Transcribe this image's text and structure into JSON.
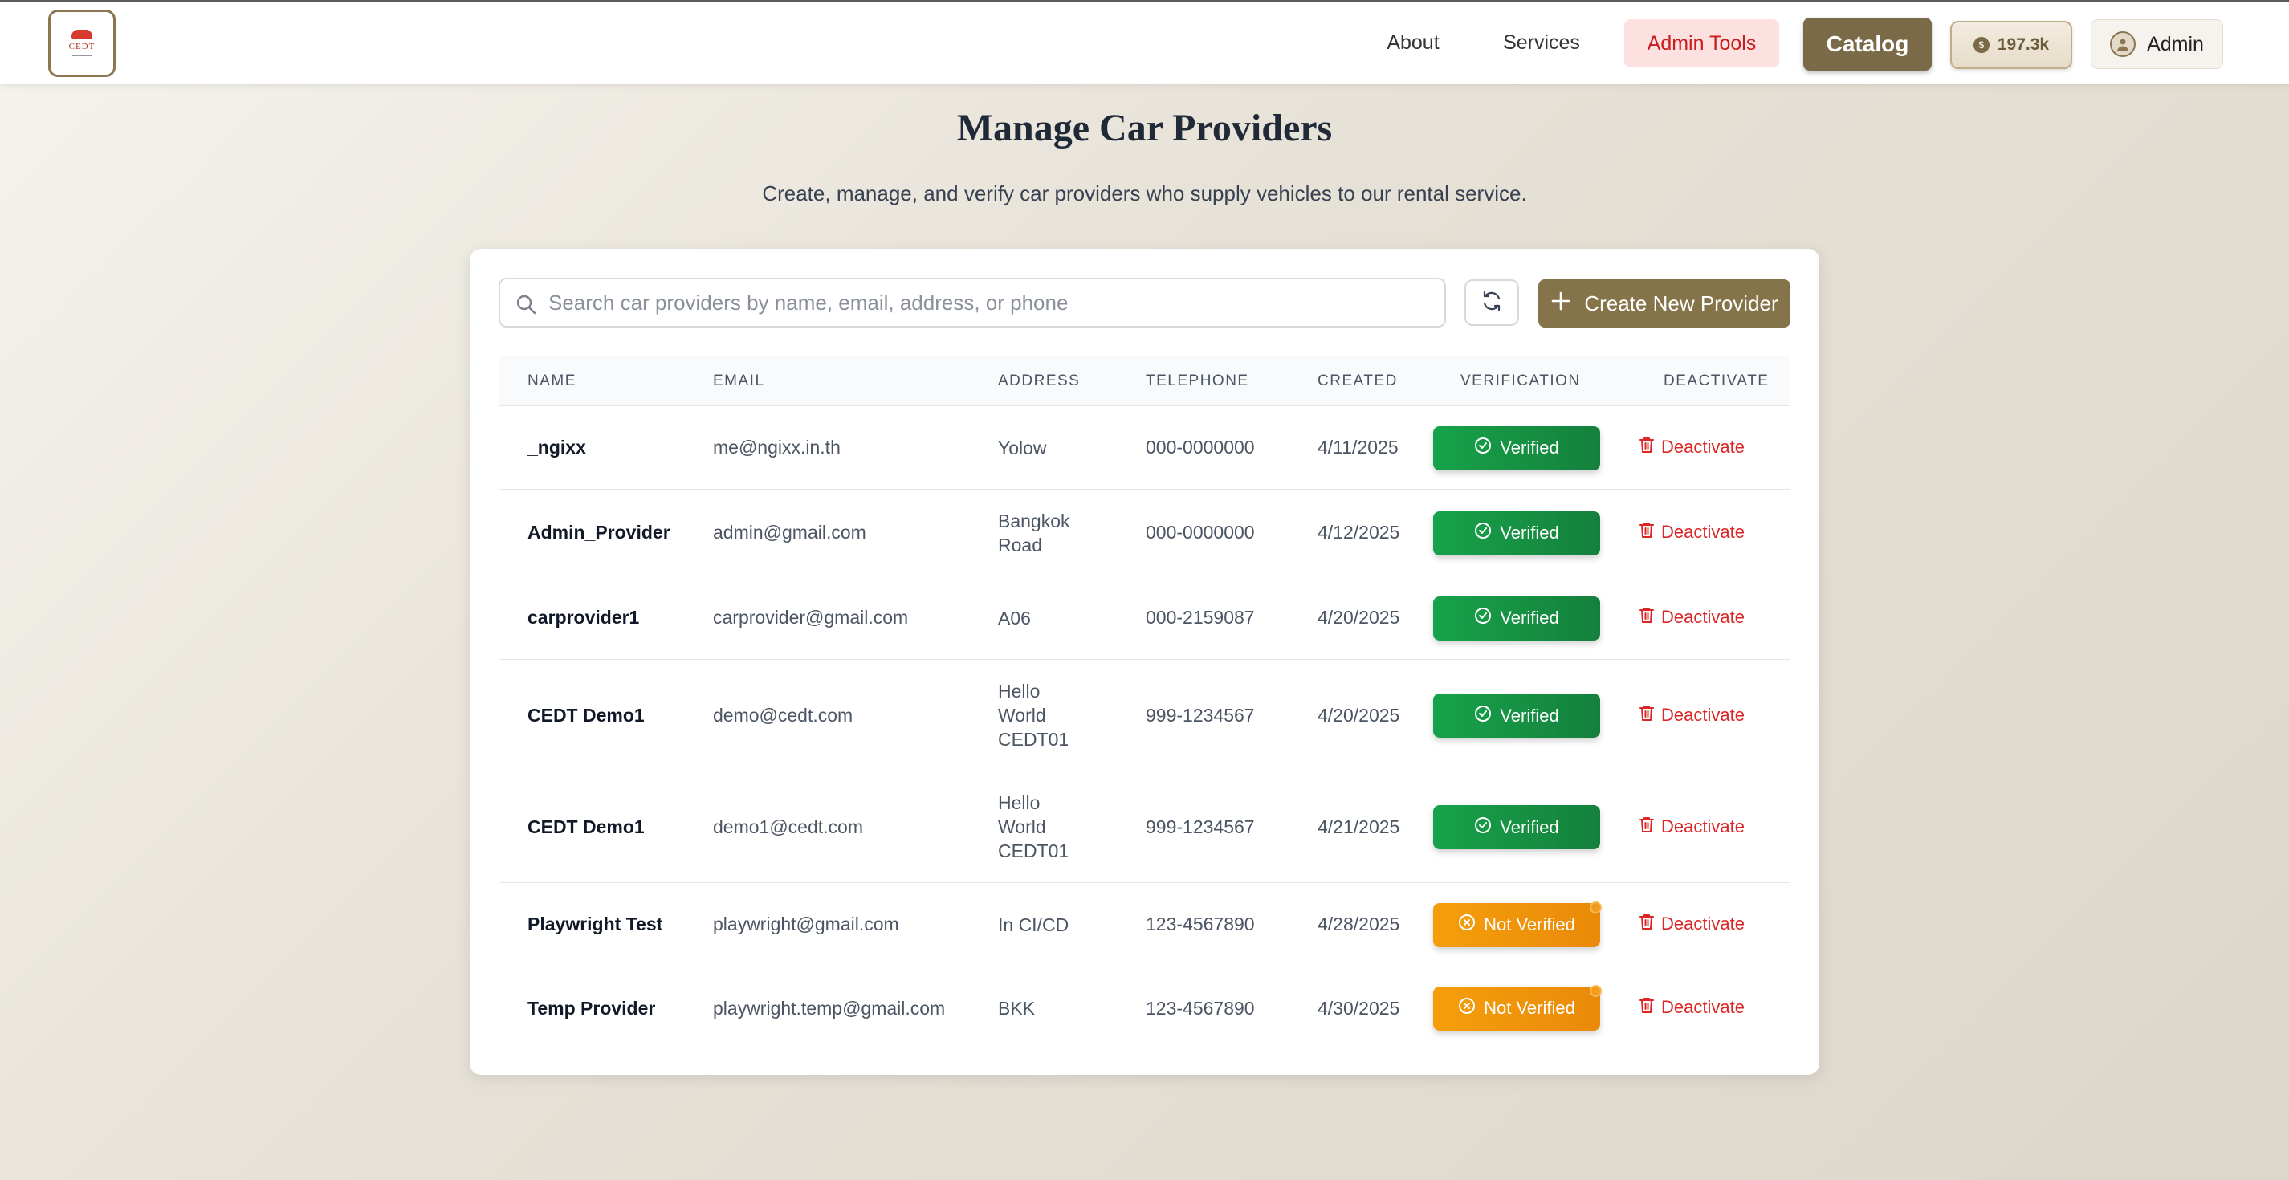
{
  "header": {
    "logo_text": "CEDT",
    "nav": {
      "about": "About",
      "services": "Services"
    },
    "admin_tools": "Admin Tools",
    "catalog": "Catalog",
    "credits": "197.3k",
    "user": "Admin"
  },
  "page": {
    "title": "Manage Car Providers",
    "subtitle": "Create, manage, and verify car providers who supply vehicles to our rental service."
  },
  "toolbar": {
    "search_placeholder": "Search car providers by name, email, address, or phone",
    "create_label": "Create New Provider"
  },
  "table": {
    "headers": [
      "NAME",
      "EMAIL",
      "ADDRESS",
      "TELEPHONE",
      "CREATED",
      "VERIFICATION",
      "DEACTIVATE"
    ],
    "rows": [
      {
        "name": "_ngixx",
        "email": "me@ngixx.in.th",
        "address": [
          "Yolow"
        ],
        "telephone": "000-0000000",
        "created": "4/11/2025",
        "verification": "Verified",
        "verified": true,
        "action": "Deactivate"
      },
      {
        "name": "Admin_Provider",
        "email": "admin@gmail.com",
        "address": [
          "Bangkok",
          "Road"
        ],
        "telephone": "000-0000000",
        "created": "4/12/2025",
        "verification": "Verified",
        "verified": true,
        "action": "Deactivate"
      },
      {
        "name": "carprovider1",
        "email": "carprovider@gmail.com",
        "address": [
          "A06"
        ],
        "telephone": "000-2159087",
        "created": "4/20/2025",
        "verification": "Verified",
        "verified": true,
        "action": "Deactivate"
      },
      {
        "name": "CEDT Demo1",
        "email": "demo@cedt.com",
        "address": [
          "Hello",
          "World",
          "CEDT01"
        ],
        "telephone": "999-1234567",
        "created": "4/20/2025",
        "verification": "Verified",
        "verified": true,
        "action": "Deactivate"
      },
      {
        "name": "CEDT Demo1",
        "email": "demo1@cedt.com",
        "address": [
          "Hello",
          "World",
          "CEDT01"
        ],
        "telephone": "999-1234567",
        "created": "4/21/2025",
        "verification": "Verified",
        "verified": true,
        "action": "Deactivate"
      },
      {
        "name": "Playwright Test",
        "email": "playwright@gmail.com",
        "address": [
          "In CI/CD"
        ],
        "telephone": "123-4567890",
        "created": "4/28/2025",
        "verification": "Not Verified",
        "verified": false,
        "action": "Deactivate"
      },
      {
        "name": "Temp Provider",
        "email": "playwright.temp@gmail.com",
        "address": [
          "BKK"
        ],
        "telephone": "123-4567890",
        "created": "4/30/2025",
        "verification": "Not Verified",
        "verified": false,
        "action": "Deactivate"
      }
    ]
  },
  "colors": {
    "accent": "#857449",
    "verified": "#16a34a",
    "not_verified": "#f59e0b",
    "danger": "#dc2626"
  },
  "icons": {
    "search": "search-icon",
    "refresh": "refresh-icon",
    "plus": "plus-icon",
    "check": "check-circle-icon",
    "x": "x-circle-icon",
    "trash": "trash-icon"
  }
}
